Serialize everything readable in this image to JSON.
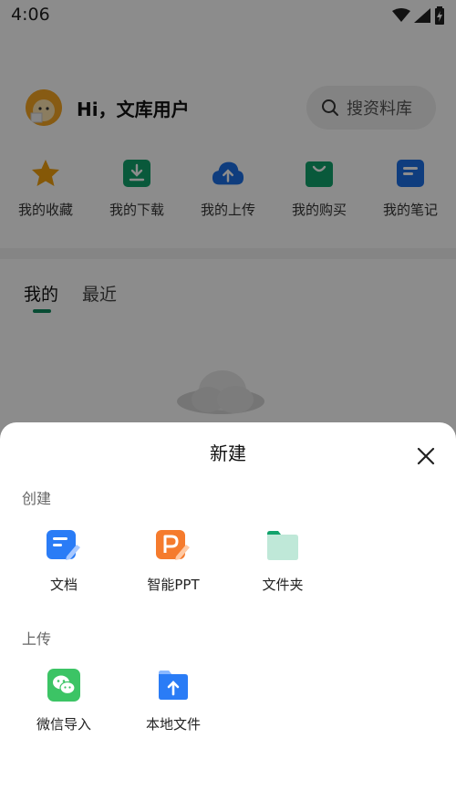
{
  "status_bar": {
    "time": "4:06"
  },
  "profile": {
    "greeting": "Hi，文库用户",
    "search_label": "搜资料库"
  },
  "quick_actions": [
    {
      "label": "我的收藏",
      "icon": "star-icon",
      "color": "#f2a10e"
    },
    {
      "label": "我的下载",
      "icon": "download-icon",
      "color": "#12a36c"
    },
    {
      "label": "我的上传",
      "icon": "cloud-upload-icon",
      "color": "#1c6fe6"
    },
    {
      "label": "我的购买",
      "icon": "shopping-bag-icon",
      "color": "#12a36c"
    },
    {
      "label": "我的笔记",
      "icon": "note-icon",
      "color": "#1c6fe6"
    }
  ],
  "tabs": [
    {
      "label": "我的",
      "active": true
    },
    {
      "label": "最近",
      "active": false
    }
  ],
  "sheet": {
    "title": "新建",
    "create_section": {
      "label": "创建",
      "items": [
        {
          "label": "文档",
          "icon": "document-icon",
          "color": "#2a7cf6"
        },
        {
          "label": "智能PPT",
          "icon": "ppt-icon",
          "color": "#f57b2d"
        },
        {
          "label": "文件夹",
          "icon": "folder-icon",
          "color": "#bfe8d8"
        }
      ]
    },
    "upload_section": {
      "label": "上传",
      "items": [
        {
          "label": "微信导入",
          "icon": "wechat-icon",
          "color": "#3cc465"
        },
        {
          "label": "本地文件",
          "icon": "local-file-upload-icon",
          "color": "#2a7cf6"
        }
      ]
    }
  }
}
